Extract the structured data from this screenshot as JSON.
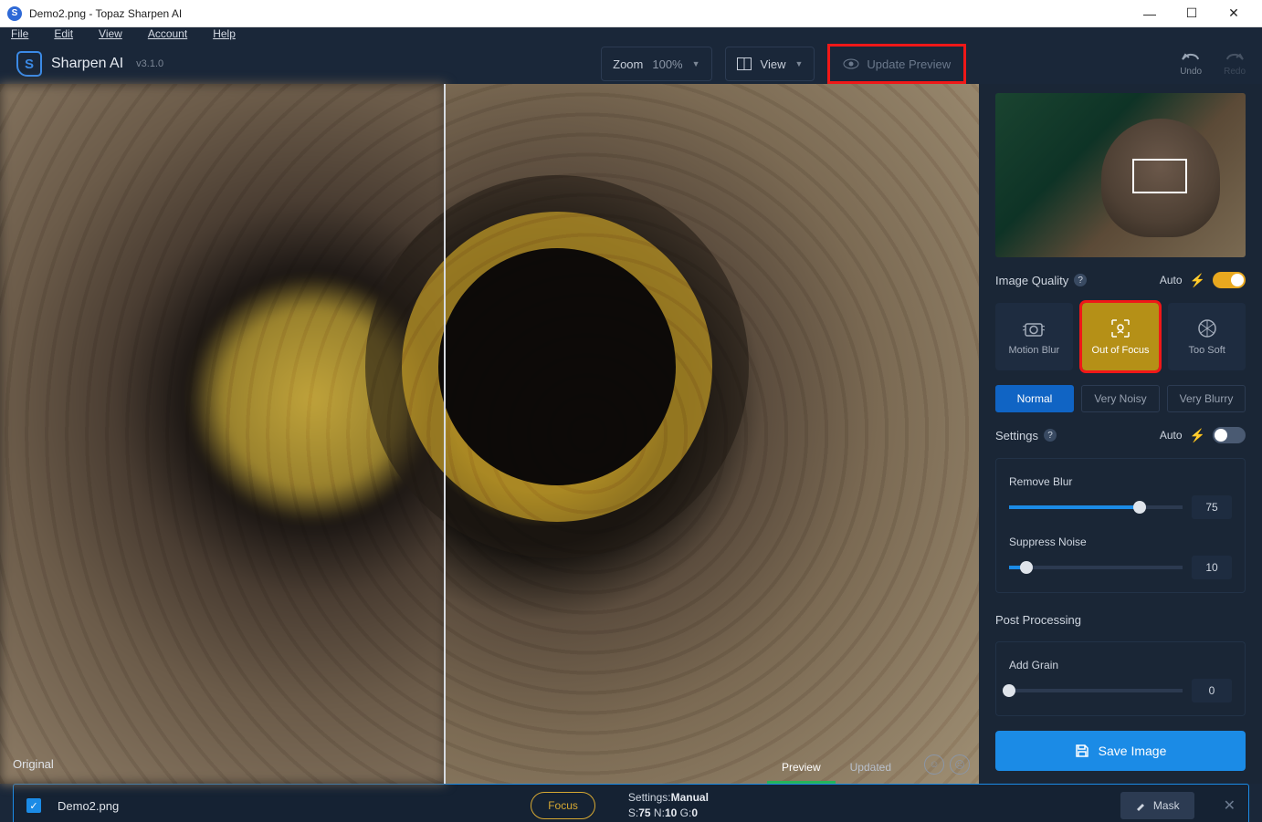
{
  "window": {
    "title": "Demo2.png - Topaz Sharpen AI"
  },
  "menu": {
    "file": "File",
    "edit": "Edit",
    "view": "View",
    "account": "Account",
    "help": "Help"
  },
  "brand": {
    "name": "Sharpen AI",
    "version": "v3.1.0",
    "mark": "S"
  },
  "toolbar": {
    "zoom_label": "Zoom",
    "zoom_value": "100%",
    "view_label": "View",
    "update_preview": "Update Preview",
    "undo": "Undo",
    "redo": "Redo"
  },
  "preview": {
    "original": "Original",
    "tabs": {
      "preview": "Preview",
      "updated": "Updated"
    }
  },
  "sidebar": {
    "image_quality": {
      "label": "Image Quality",
      "auto": "Auto"
    },
    "modes": {
      "motion_blur": "Motion Blur",
      "out_of_focus": "Out of Focus",
      "too_soft": "Too Soft"
    },
    "sub": {
      "normal": "Normal",
      "very_noisy": "Very Noisy",
      "very_blurry": "Very Blurry"
    },
    "settings": {
      "label": "Settings",
      "auto": "Auto"
    },
    "remove_blur": {
      "label": "Remove Blur",
      "value": "75",
      "pct": 75
    },
    "suppress_noise": {
      "label": "Suppress Noise",
      "value": "10",
      "pct": 10
    },
    "post_processing": "Post Processing",
    "add_grain": {
      "label": "Add Grain",
      "value": "0",
      "pct": 0
    },
    "save": "Save Image"
  },
  "footer": {
    "filename": "Demo2.png",
    "pill": "Focus",
    "meta_settings": "Settings:",
    "meta_mode": "Manual",
    "meta_line2_s": "S:",
    "meta_s": "75",
    "meta_n_lbl": " N:",
    "meta_n": "10",
    "meta_g_lbl": " G:",
    "meta_g": "0",
    "mask": "Mask"
  }
}
